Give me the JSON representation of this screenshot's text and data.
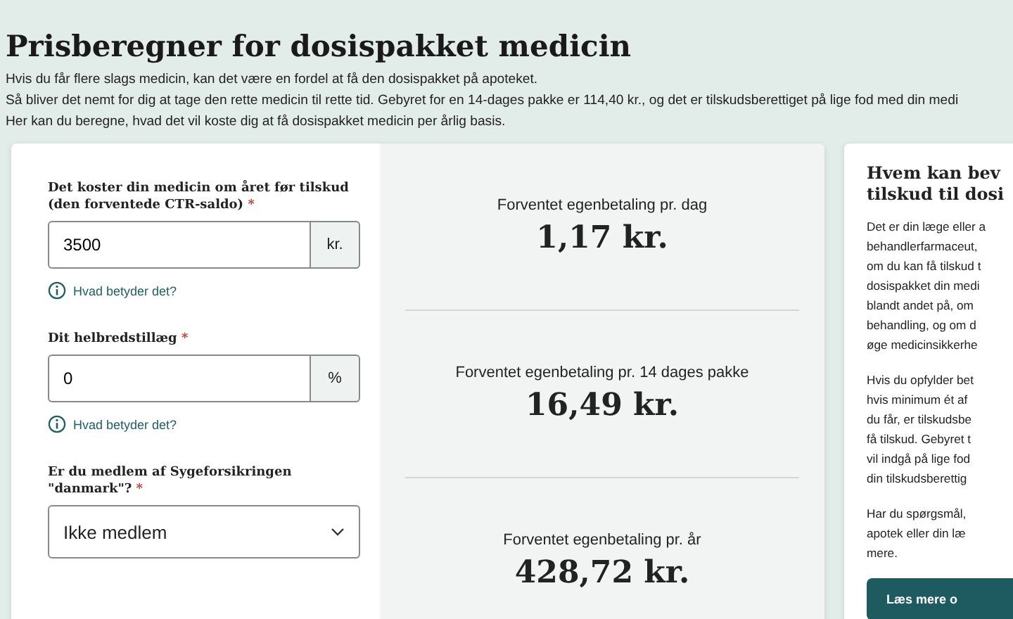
{
  "title": "Prisberegner for dosispakket medicin",
  "intro": [
    "Hvis du får flere slags medicin, kan det være en fordel at få den dosispakket på apoteket.",
    "Så bliver det nemt for dig at tage den rette medicin til rette tid. Gebyret for en 14-dages pakke er 114,40 kr., og det er tilskudsberettiget på lige fod med din medi",
    "Her kan du beregne, hvad det vil koste dig at få dosispakket medicin per årlig basis."
  ],
  "form": [
    {
      "kind": "input",
      "label": "Det koster din medicin om året før tilskud (den forventede CTR-saldo)",
      "required": "*",
      "value": "3500",
      "unit": "kr.",
      "help": "Hvad betyder det?"
    },
    {
      "kind": "input",
      "label": "Dit helbredstillæg",
      "required": "*",
      "value": "0",
      "unit": "%",
      "help": "Hvad betyder det?"
    },
    {
      "kind": "select",
      "label": "Er du medlem af Sygeforsikringen \"danmark\"?",
      "required": "*",
      "value": "Ikke medlem"
    }
  ],
  "results": [
    {
      "label": "Forventet egenbetaling pr. dag",
      "amount": "1,17 kr."
    },
    {
      "label": "Forventet egenbetaling pr. 14 dages pakke",
      "amount": "16,49 kr."
    },
    {
      "label": "Forventet egenbetaling pr. år",
      "amount": "428,72 kr."
    }
  ],
  "info": {
    "heading": [
      "Hvem kan bev",
      "tilskud til dosi"
    ],
    "paragraphs": [
      [
        "Det er din læge eller a",
        "behandlerfarmaceut,",
        "om du kan få tilskud t",
        "dosispakket din medi",
        "blandt andet på, om",
        "behandling, og om d",
        "øge medicinsikkerhe"
      ],
      [
        "Hvis du opfylder bet",
        "hvis minimum ét af",
        "du får, er tilskudsbe",
        "få tilskud. Gebyret t",
        "vil indgå på lige fod",
        "din tilskudsberettig"
      ],
      [
        "Har du spørgsmål,",
        "apotek eller din læ",
        "mere."
      ]
    ],
    "button": "Læs mere o"
  }
}
